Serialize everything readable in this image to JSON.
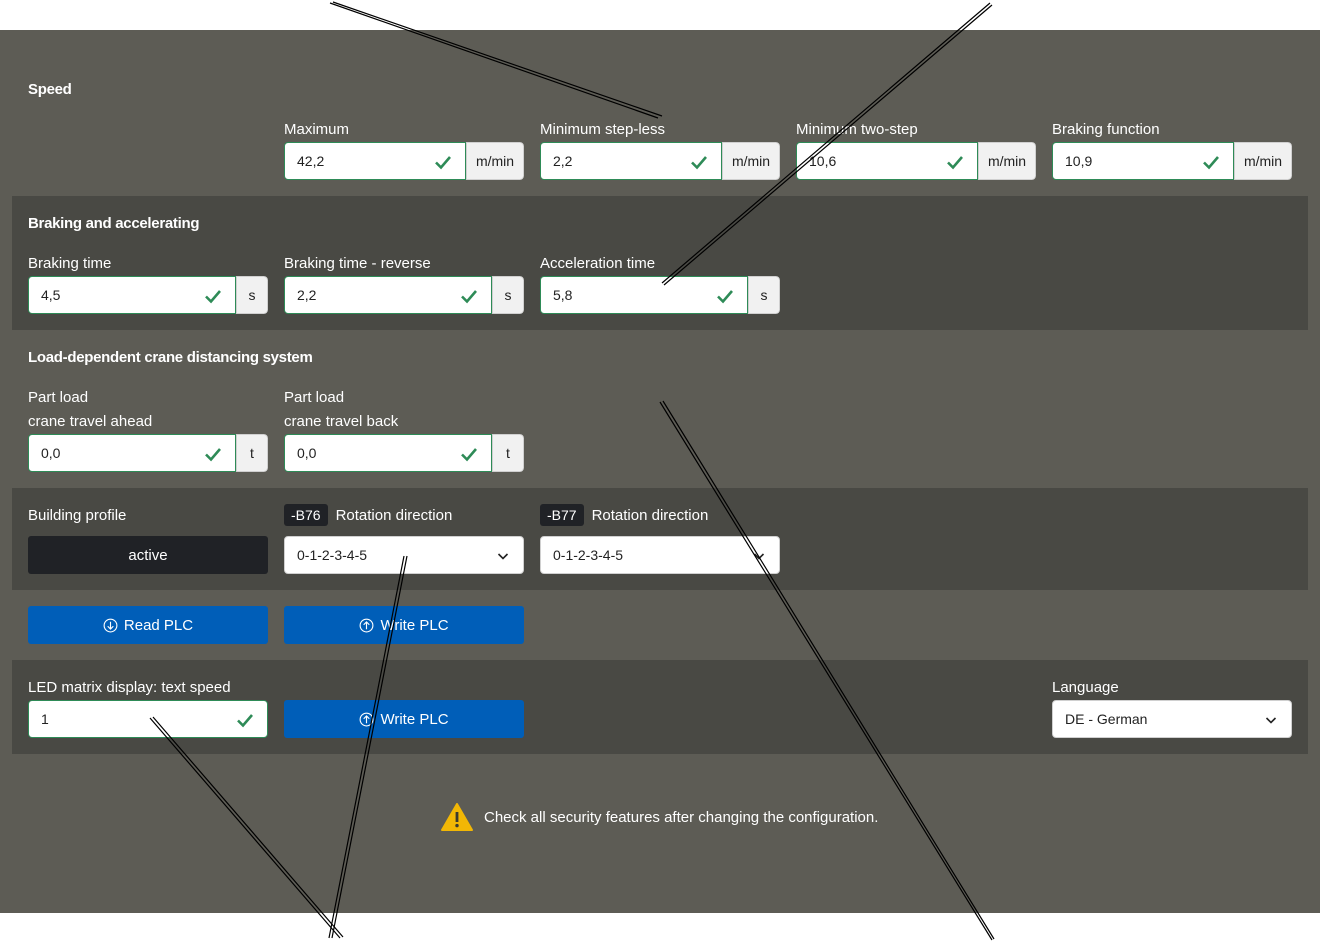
{
  "speed": {
    "title": "Speed",
    "fields": [
      {
        "label": "Maximum",
        "value": "42,2",
        "unit": "m/min"
      },
      {
        "label": "Minimum step-less",
        "value": "2,2",
        "unit": "m/min"
      },
      {
        "label": "Minimum two-step",
        "value": "10,6",
        "unit": "m/min"
      },
      {
        "label": "Braking function",
        "value": "10,9",
        "unit": "m/min"
      }
    ]
  },
  "braking": {
    "title": "Braking and accelerating",
    "fields": [
      {
        "label": "Braking time",
        "value": "4,5",
        "unit": "s"
      },
      {
        "label": "Braking time - reverse",
        "value": "2,2",
        "unit": "s"
      },
      {
        "label": "Acceleration time",
        "value": "5,8",
        "unit": "s"
      }
    ]
  },
  "distancing": {
    "title": "Load-dependent crane distancing system",
    "fields": [
      {
        "label1": "Part load",
        "label2": "crane travel ahead",
        "value": "0,0",
        "unit": "t"
      },
      {
        "label1": "Part load",
        "label2": "crane travel back",
        "value": "0,0",
        "unit": "t"
      }
    ]
  },
  "profile": {
    "building_label": "Building profile",
    "building_button": "active",
    "b76": {
      "tag": "-B76",
      "label": "Rotation direction",
      "value": "0-1-2-3-4-5"
    },
    "b77": {
      "tag": "-B77",
      "label": "Rotation direction",
      "value": "0-1-2-3-4-5"
    }
  },
  "plc": {
    "read_label": "Read PLC",
    "write_label": "Write PLC"
  },
  "led": {
    "label": "LED matrix display: text speed",
    "value": "1",
    "write_label": "Write PLC",
    "language_label": "Language",
    "language_value": "DE - German"
  },
  "warning": {
    "text": "Check all security features after changing the configuration."
  },
  "colors": {
    "panel": "#5d5c55",
    "band": "#494944",
    "accent_blue": "#005eb8",
    "check_green": "#2e8b57",
    "warning_yellow": "#f2b705"
  }
}
